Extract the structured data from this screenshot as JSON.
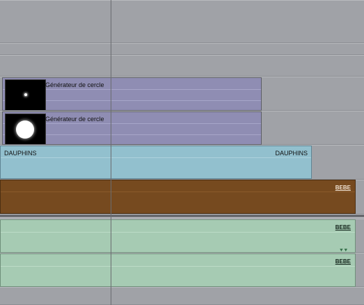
{
  "tracks": {
    "generator_clips": [
      {
        "label": "Générateur de cercle"
      },
      {
        "label": "Générateur de cercle"
      }
    ],
    "dauphins_clip": {
      "label_left": "DAUPHINS",
      "label_right": "DAUPHINS"
    },
    "bebe_video_clip": {
      "marker": "BEBE"
    },
    "bebe_audio_clips": [
      {
        "marker": "BEBE"
      },
      {
        "marker": "BEBE"
      }
    ]
  },
  "keyframe_glyph": "⯆⯆",
  "colors": {
    "background": "#a0a2a7",
    "generator_clip": "#8f8db3",
    "dauphins_clip": "#92c0ce",
    "bebe_video_clip": "#764a1f",
    "bebe_audio_clip": "#a6cbb3",
    "playhead": "#6a6c70"
  }
}
